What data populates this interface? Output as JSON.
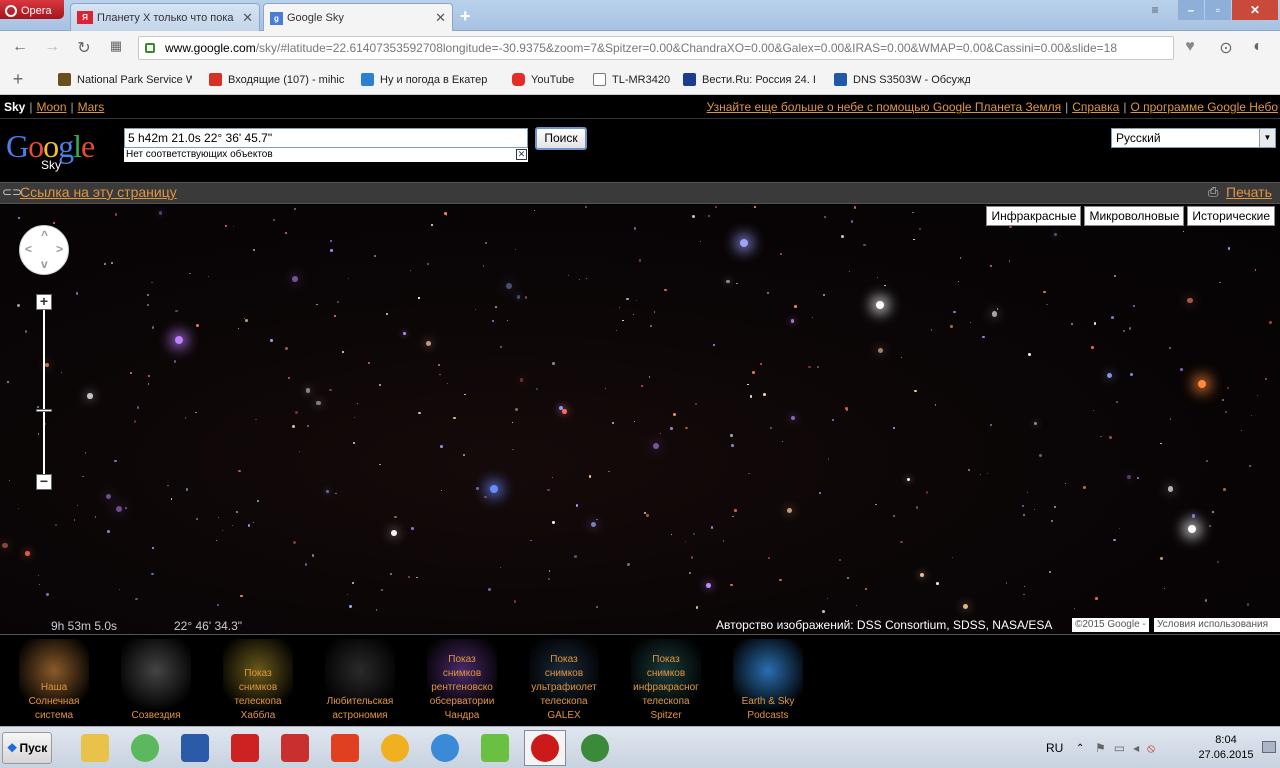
{
  "browser": {
    "app_name": "Opera",
    "tabs": [
      {
        "icon": "yandex-icon",
        "title": "Планету Х только что пока",
        "active": false
      },
      {
        "icon": "google-icon",
        "title": "Google Sky",
        "active": true
      }
    ],
    "url": {
      "host": "www.google.com",
      "rest": "/sky/#latitude=22.61407353592708longitude=-30.9375&zoom=7&Spitzer=0.00&ChandraXO=0.00&Galex=0.00&IRAS=0.00&WMAP=0.00&Cassini=0.00&slide=18"
    },
    "bookmarks": [
      {
        "label": "National Park Service W",
        "icon": "nps-icon",
        "color": "#6b4e1e"
      },
      {
        "label": "Входящие (107) - mihic",
        "icon": "gmail-icon",
        "color": "#d93025"
      },
      {
        "label": "Ну и погода в Екатер",
        "icon": "weather-icon",
        "color": "#2d7fd2"
      },
      {
        "label": "YouTube",
        "icon": "youtube-icon",
        "color": "#e52d27"
      },
      {
        "label": "TL-MR3420",
        "icon": "page-icon",
        "color": "#777777"
      },
      {
        "label": "Вести.Ru: Россия 24. I",
        "icon": "vesti-icon",
        "color": "#1a3d8f"
      },
      {
        "label": "DNS S3503W - Обсужд",
        "icon": "dns-icon",
        "color": "#1e5aa8"
      }
    ]
  },
  "sky": {
    "topnav": {
      "sky": "Sky",
      "moon": "Moon",
      "mars": "Mars",
      "earth_link": "Узнайте еще больше о небе с помощью Google Планета Земля",
      "help": "Справка",
      "about": "О программе Google Небо"
    },
    "logo": {
      "text": "Google",
      "sub": "Sky"
    },
    "search": {
      "value": "5 h42m 21.0s 22° 36' 45.7\"",
      "suggest": "Нет соответствующих объектов",
      "button": "Поиск"
    },
    "language": "Русский",
    "link_label": "Ссылка на эту страницу",
    "print_label": "Печать",
    "wave_buttons": [
      "Инфракрасные",
      "Микроволновые",
      "Исторические"
    ],
    "coords": {
      "ra": "9h 53m 5.0s",
      "dec": "22° 46' 34.3\""
    },
    "credit": "Авторство изображений: DSS Consortium, SDSS, NASA/ESA",
    "copyright": "©2015 Google -",
    "terms": "Условия использования",
    "gallery": [
      {
        "lines": [
          "Наша",
          "Солнечная",
          "система"
        ],
        "icon": "solar-system-icon",
        "color": "#8a5a2a"
      },
      {
        "lines": [
          "Созвездия"
        ],
        "icon": "constellation-icon",
        "color": "#444444"
      },
      {
        "lines": [
          "Показ",
          "снимков",
          "телескопа",
          "Хаббла"
        ],
        "icon": "hubble-icon",
        "color": "#6a5a1a"
      },
      {
        "lines": [
          "Любительская",
          "астрономия"
        ],
        "icon": "galaxy-icon",
        "color": "#2a2a2a"
      },
      {
        "lines": [
          "Показ",
          "снимков",
          "рентгеновско",
          "обсерватории",
          "Чандра"
        ],
        "icon": "chandra-icon",
        "color": "#4a2a6a"
      },
      {
        "lines": [
          "Показ",
          "снимков",
          "ультрафиолет",
          "телескопа",
          "GALEX"
        ],
        "icon": "galex-icon",
        "color": "#1a2a3a"
      },
      {
        "lines": [
          "Показ",
          "снимков",
          "инфракрасног",
          "телескопа",
          "Spitzer"
        ],
        "icon": "spitzer-icon",
        "color": "#1a3a3a"
      },
      {
        "lines": [
          "Earth & Sky",
          "Podcasts"
        ],
        "icon": "podcast-icon",
        "color": "#2a6fb0"
      }
    ]
  },
  "taskbar": {
    "start": "Пуск",
    "apps": [
      {
        "icon": "explorer-icon",
        "color": "#e8c24a"
      },
      {
        "icon": "utorrent-icon",
        "color": "#5cb85c"
      },
      {
        "icon": "calculator-icon",
        "color": "#2a5aa8"
      },
      {
        "icon": "acrobat-icon",
        "color": "#cc2222"
      },
      {
        "icon": "ro-icon",
        "color": "#c83030"
      },
      {
        "icon": "sunburst-icon",
        "color": "#e04020"
      },
      {
        "icon": "aimp-icon",
        "color": "#f0b020"
      },
      {
        "icon": "messenger-icon",
        "color": "#3a8ad8"
      },
      {
        "icon": "leaf-icon",
        "color": "#6ac040"
      },
      {
        "icon": "opera-icon",
        "color": "#cc1a1a"
      },
      {
        "icon": "chrome-icon",
        "color": "#3a8a3a"
      }
    ],
    "lang": "RU",
    "time": "8:04",
    "date": "27.06.2015"
  }
}
